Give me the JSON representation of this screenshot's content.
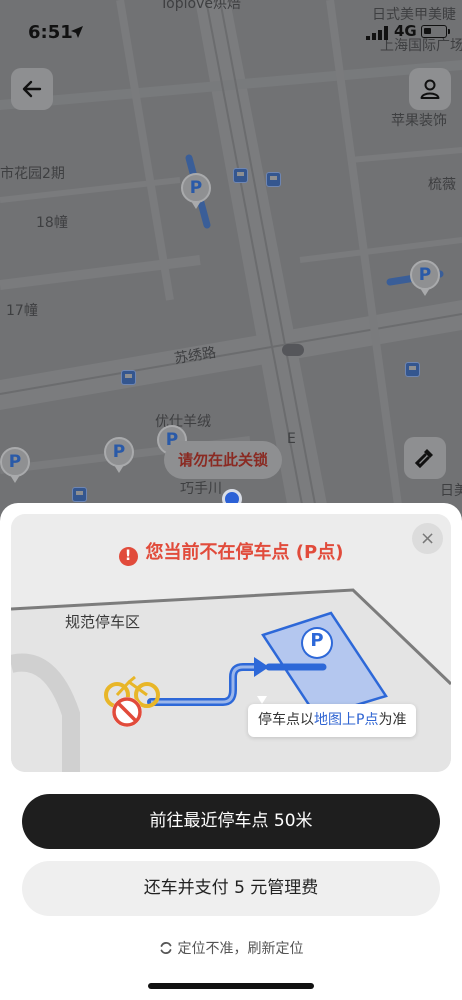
{
  "status_bar": {
    "time": "6:51",
    "network": "4G"
  },
  "map": {
    "labels": {
      "top_center": "Toplove烘焙",
      "top_right_1": "日式美甲美睫",
      "top_right_2": "上海国际广场",
      "apple": "苹果装饰",
      "garden": "市花园2期",
      "building18": "18幢",
      "building17": "17幢",
      "road": "苏绣路",
      "store": "优仕羊绒",
      "right_edge": "梳薇",
      "right_edge2": "日美",
      "bottom_partial": "巧手川",
      "bottom_right_partial": "E"
    },
    "parking_marker": "P",
    "notice": "请勿在此关锁"
  },
  "sheet": {
    "title": "您当前不在停车点 (P点)",
    "warn_glyph": "!",
    "close_glyph": "×",
    "zone_label": "规范停车区",
    "parking_marker": "P",
    "tooltip_prefix": "停车点以",
    "tooltip_highlight": "地图上P点",
    "tooltip_suffix": "为准"
  },
  "actions": {
    "primary": "前往最近停车点 50米",
    "secondary": "还车并支付 5 元管理费",
    "refresh": "定位不准，刷新定位"
  },
  "colors": {
    "warning": "#e14b3b",
    "primary_button": "#1e1e1e",
    "highlight": "#2f64d2"
  }
}
